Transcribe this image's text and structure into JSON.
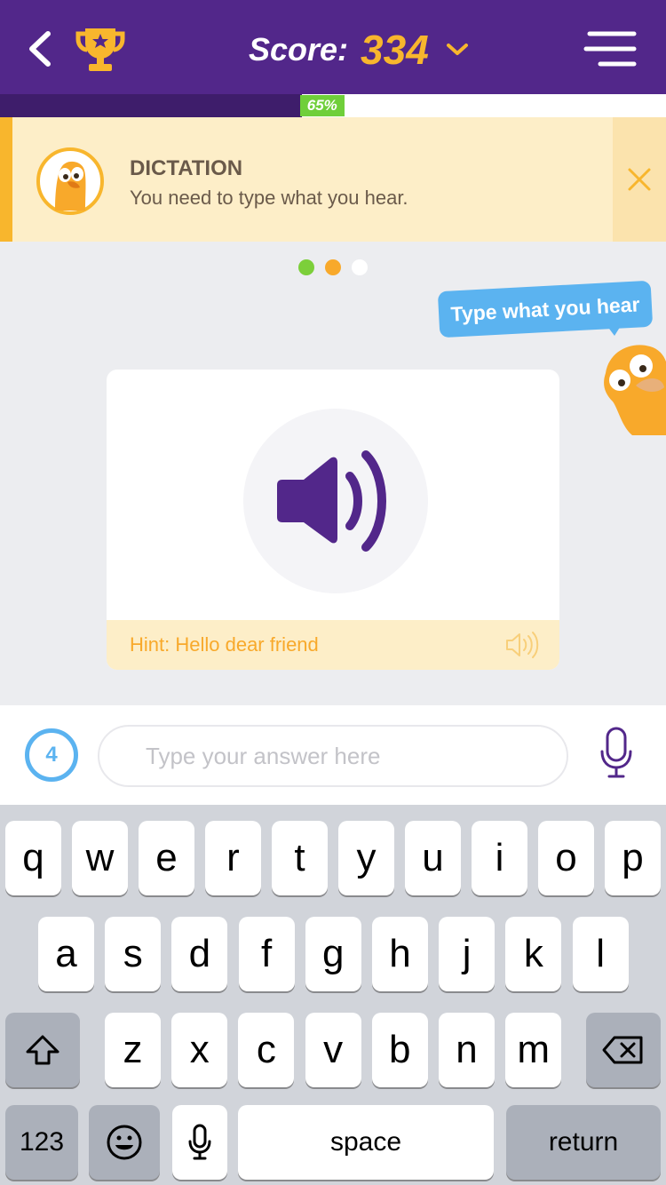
{
  "header": {
    "score_label": "Score:",
    "score_value": "334"
  },
  "progress": {
    "percent": 65,
    "label": "65%"
  },
  "banner": {
    "title": "DICTATION",
    "text": "You need to type what you hear."
  },
  "steps": [
    {
      "color": "#7ccf3a"
    },
    {
      "color": "#f8a92b"
    },
    {
      "color": "#ffffff"
    }
  ],
  "bubble": {
    "text": "Type what you hear"
  },
  "card": {
    "hint": "Hint: Hello dear friend"
  },
  "answer": {
    "attempts": "4",
    "placeholder": "Type your answer here"
  },
  "keyboard": {
    "row1": [
      "q",
      "w",
      "e",
      "r",
      "t",
      "y",
      "u",
      "i",
      "o",
      "p"
    ],
    "row2": [
      "a",
      "s",
      "d",
      "f",
      "g",
      "h",
      "j",
      "k",
      "l"
    ],
    "row3": [
      "z",
      "x",
      "c",
      "v",
      "b",
      "n",
      "m"
    ],
    "numbers": "123",
    "space": "space",
    "return": "return",
    "icons": [
      "shift-icon",
      "backspace-icon",
      "emoji-icon",
      "dictation-icon"
    ]
  },
  "colors": {
    "brand_purple": "#52278a",
    "accent_orange": "#f8b62d",
    "progress_green": "#6fcf3a",
    "bubble_blue": "#5bb3f0"
  }
}
